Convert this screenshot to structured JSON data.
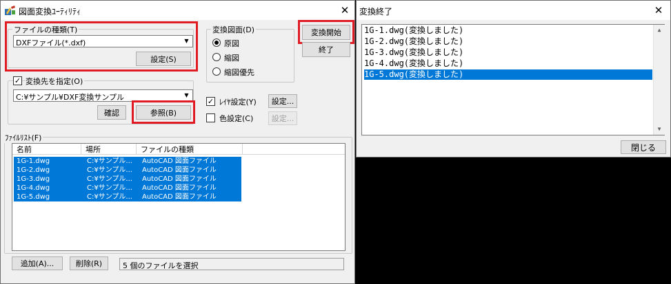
{
  "main_window": {
    "title": "図面変換ﾕｰﾃｨﾘﾃｨ",
    "close_glyph": "✕",
    "file_type_group": {
      "label": "ファイルの種類(T)",
      "selected": "DXFファイル(*.dxf)",
      "settings_button": "設定(S)"
    },
    "conversion_drawing_group": {
      "label": "変換図面(D)",
      "options": [
        "原図",
        "縮図",
        "縮図優先"
      ],
      "selected_index": 0
    },
    "start_button": "変換開始",
    "exit_button": "終了",
    "destination_group": {
      "checkbox_label": "変換先を指定(O)",
      "checked": true,
      "path": "C:¥サンプル¥DXF変換サンプル",
      "confirm_button": "確認",
      "browse_button": "参照(B)"
    },
    "layer_setting": {
      "label": "ﾚｲﾔ設定(Y)",
      "checked": true,
      "button": "設定..."
    },
    "color_setting": {
      "label": "色設定(C)",
      "checked": false,
      "button": "設定..."
    },
    "file_list_group": {
      "label": "ﾌｧｲﾙﾘｽﾄ(F)",
      "columns": [
        "名前",
        "場所",
        "ファイルの種類"
      ],
      "rows": [
        {
          "name": "1G-1.dwg",
          "location": "C:¥サンプル...",
          "type": "AutoCAD 図面ファイル"
        },
        {
          "name": "1G-2.dwg",
          "location": "C:¥サンプル...",
          "type": "AutoCAD 図面ファイル"
        },
        {
          "name": "1G-3.dwg",
          "location": "C:¥サンプル...",
          "type": "AutoCAD 図面ファイル"
        },
        {
          "name": "1G-4.dwg",
          "location": "C:¥サンプル...",
          "type": "AutoCAD 図面ファイル"
        },
        {
          "name": "1G-5.dwg",
          "location": "C:¥サンプル...",
          "type": "AutoCAD 図面ファイル"
        }
      ]
    },
    "add_button": "追加(A)...",
    "remove_button": "削除(R)",
    "status_text": "5 個のファイルを選択"
  },
  "result_window": {
    "title": "変換終了",
    "close_glyph": "✕",
    "lines": [
      "1G-1.dwg(変換しました)",
      "1G-2.dwg(変換しました)",
      "1G-3.dwg(変換しました)",
      "1G-4.dwg(変換しました)",
      "1G-5.dwg(変換しました)"
    ],
    "selected_index": 4,
    "close_button": "閉じる"
  },
  "colors": {
    "highlight_red": "#e01b24",
    "selection_blue": "#0078d7",
    "window_bg": "#f0f0f0"
  },
  "icons": {
    "app": "cad-app-icon",
    "close": "close-icon",
    "dropdown": "chevron-down-icon",
    "scroll_up": "scroll-up-arrow-icon",
    "scroll_down": "scroll-down-arrow-icon"
  }
}
